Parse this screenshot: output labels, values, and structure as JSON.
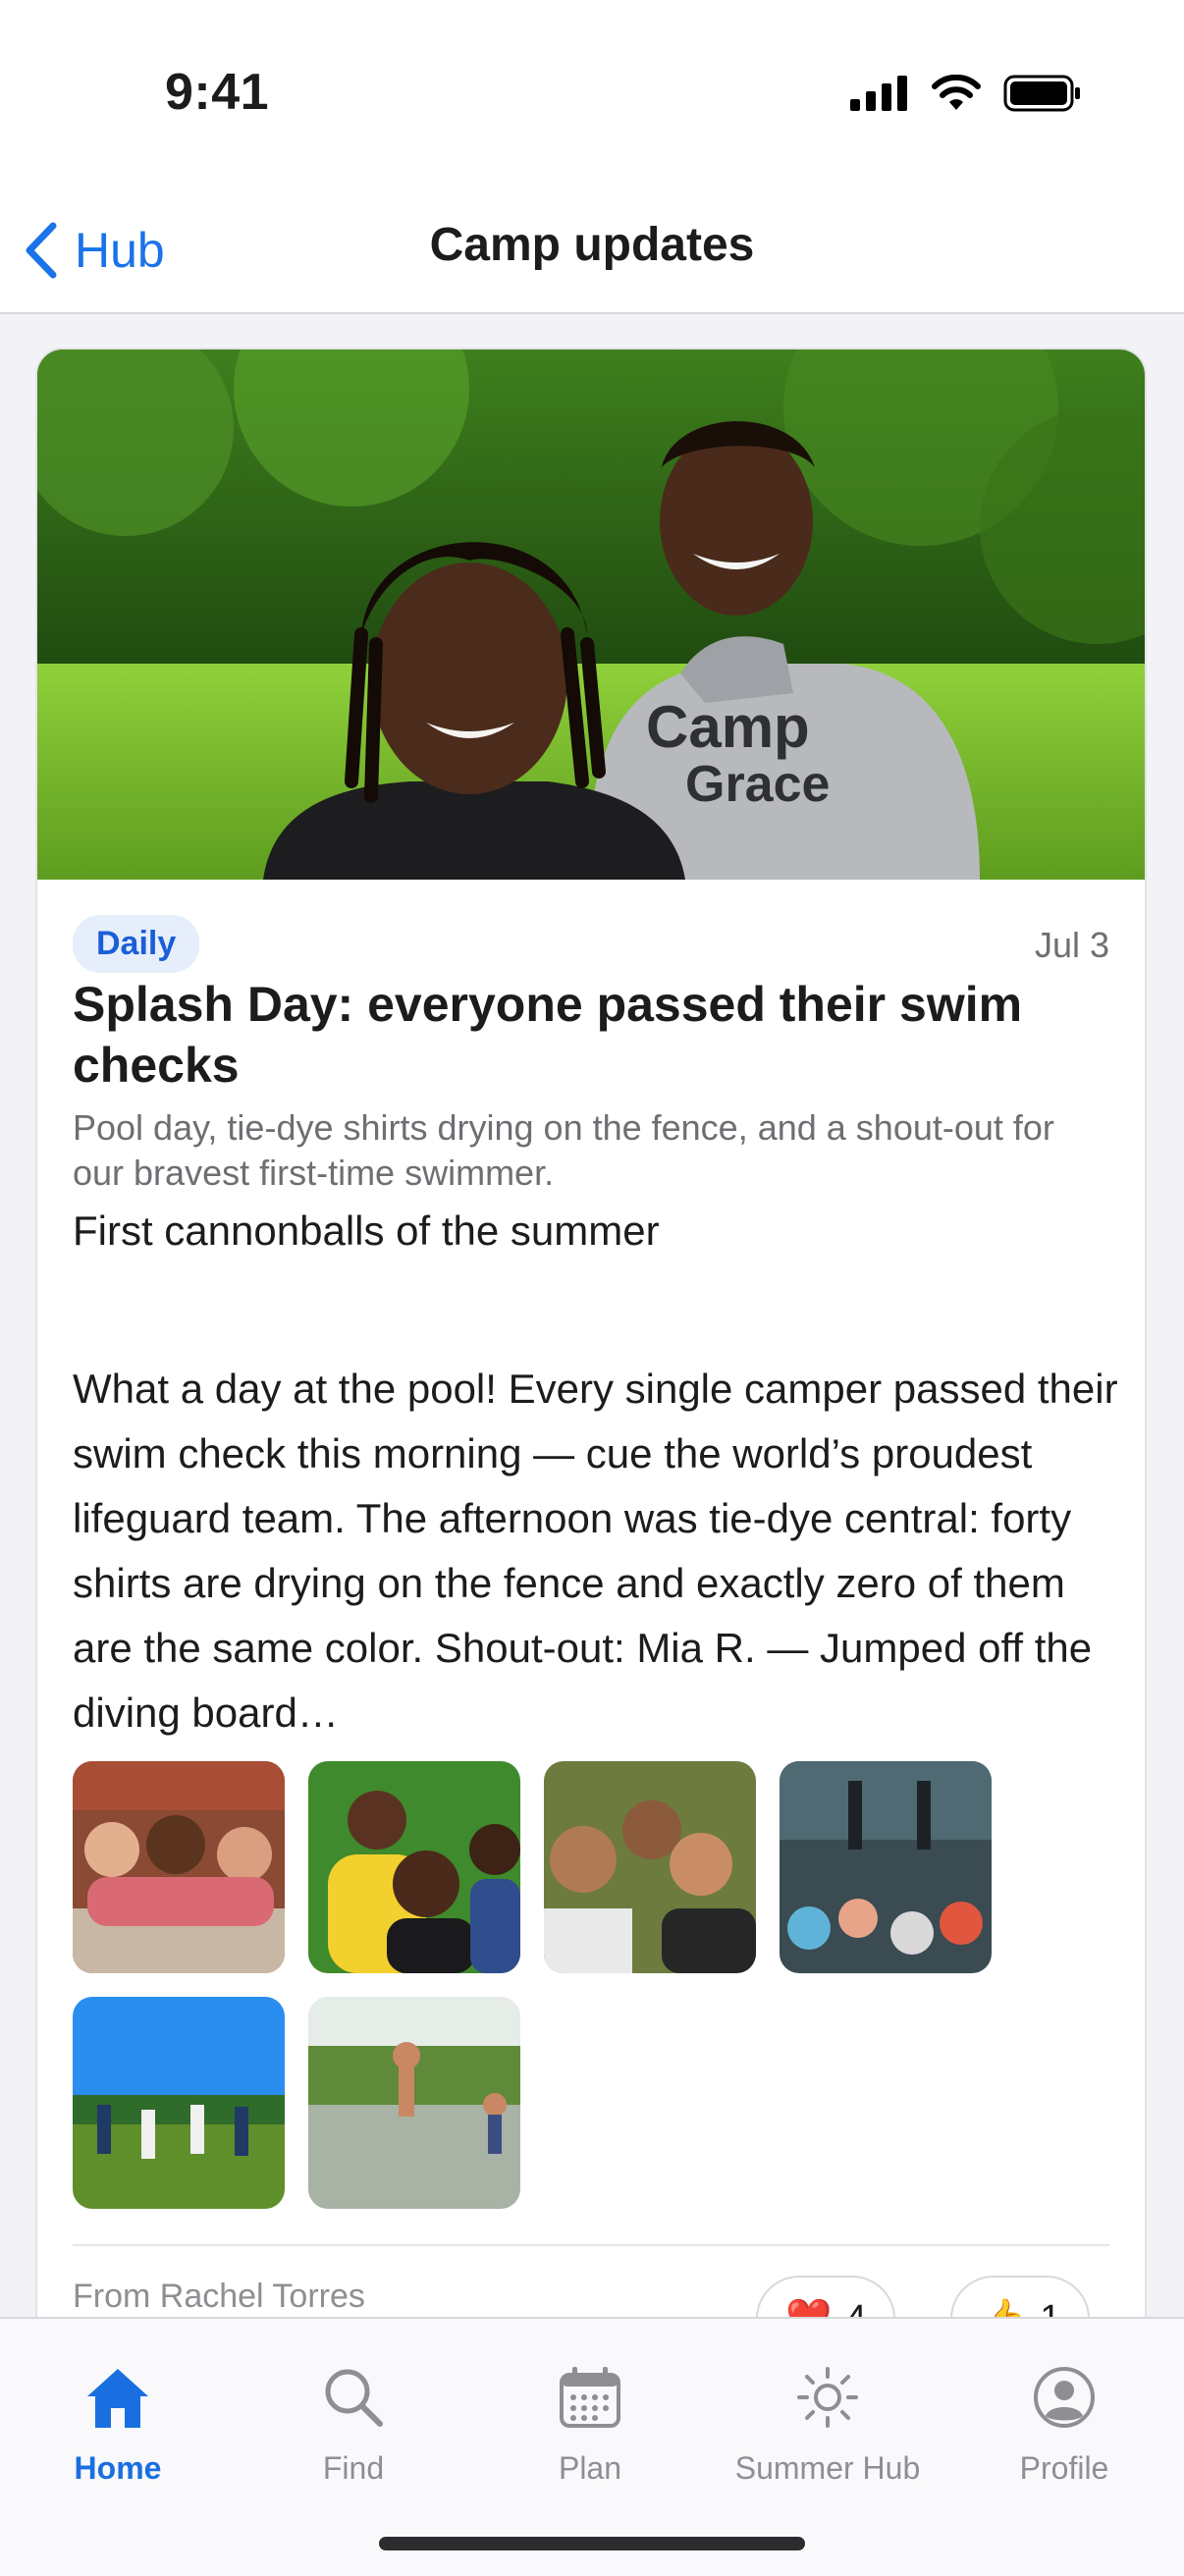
{
  "status_bar": {
    "time": "9:41"
  },
  "nav": {
    "back_label": "Hub",
    "title": "Camp updates"
  },
  "post": {
    "category": "Daily",
    "date": "Jul 3",
    "title": "Splash Day: everyone passed their swim checks",
    "subtitle": "Pool day, tie-dye shirts drying on the fence, and a shout-out for our bravest first-time swimmer.",
    "lead": "First cannonballs of the summer",
    "body": "What a day at the pool! Every single camper passed their swim check this morning — cue the world’s proudest lifeguard team. The afternoon was tie-dye central: forty shirts are drying on the fence and exactly zero of them are the same color. Shout-out: Mia R. — Jumped off the diving board…",
    "photos": [
      {
        "name": "photo-kids-group"
      },
      {
        "name": "photo-kids-outdoors"
      },
      {
        "name": "photo-boys-laughing"
      },
      {
        "name": "photo-worship-crowd"
      },
      {
        "name": "photo-field-game"
      },
      {
        "name": "photo-lake-jump"
      }
    ],
    "author": "From Rachel Torres",
    "reactions": [
      {
        "emoji": "❤️",
        "count": "4"
      },
      {
        "emoji": "👍",
        "count": "1"
      }
    ]
  },
  "tabs": [
    {
      "label": "Home",
      "icon": "house-icon",
      "active": true
    },
    {
      "label": "Find",
      "icon": "magnifier-icon",
      "active": false
    },
    {
      "label": "Plan",
      "icon": "calendar-icon",
      "active": false
    },
    {
      "label": "Summer Hub",
      "icon": "sun-icon",
      "active": false
    },
    {
      "label": "Profile",
      "icon": "person-circle-icon",
      "active": false
    }
  ],
  "colors": {
    "accent": "#1a73e8",
    "badge_bg": "#e6eefc",
    "muted": "#8e8e93"
  }
}
